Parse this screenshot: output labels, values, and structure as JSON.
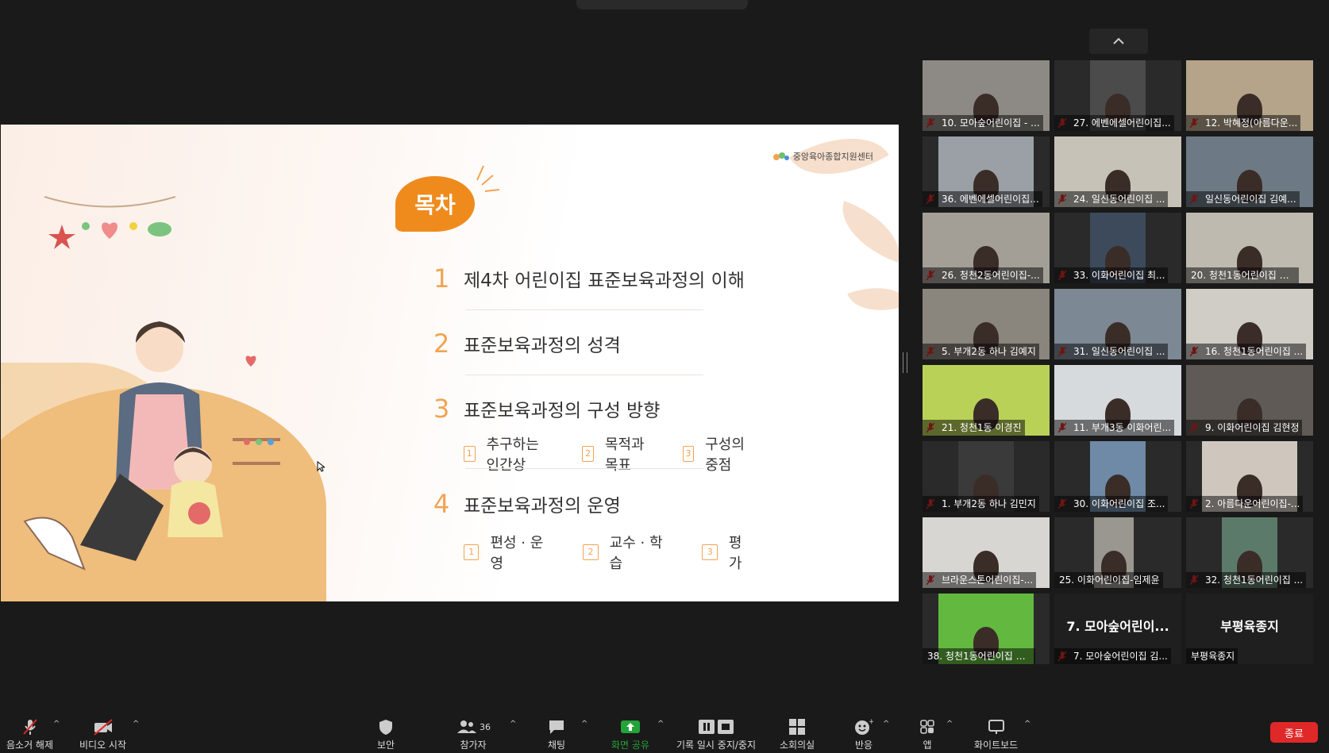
{
  "slide": {
    "logo_text": "중앙육아종합지원센터",
    "bubble_title": "목차",
    "items": [
      {
        "num": "1",
        "title": "제4차 어린이집 표준보육과정의 이해"
      },
      {
        "num": "2",
        "title": "표준보육과정의 성격"
      },
      {
        "num": "3",
        "title": "표준보육과정의 구성 방향",
        "subs": [
          {
            "n": "1",
            "label": "추구하는 인간상"
          },
          {
            "n": "2",
            "label": "목적과 목표"
          },
          {
            "n": "3",
            "label": "구성의 중점"
          }
        ]
      },
      {
        "num": "4",
        "title": "표준보육과정의 운영",
        "subs": [
          {
            "n": "1",
            "label": "편성 · 운영"
          },
          {
            "n": "2",
            "label": "교수 · 학습"
          },
          {
            "n": "3",
            "label": "평가"
          }
        ]
      }
    ],
    "accent": "#ef8b1d"
  },
  "participants": [
    {
      "label": "10. 모아숲어린이집 - ...",
      "muted": true
    },
    {
      "label": "27. 에벤에셀어린이집...",
      "muted": true
    },
    {
      "label": "12. 박혜정(아름다운...",
      "muted": true
    },
    {
      "label": "36. 에벤에셀어린이집...",
      "muted": true
    },
    {
      "label": "24. 일신동어린이집 ...",
      "muted": true
    },
    {
      "label": "일신동어린이집 김예...",
      "muted": true
    },
    {
      "label": "26. 청천2동어린이집-...",
      "muted": true
    },
    {
      "label": "33. 이화어린이집 최...",
      "muted": true
    },
    {
      "label": "20. 청천1동어린이집 유...",
      "muted": false
    },
    {
      "label": "5. 부개2동 하나 김예지",
      "muted": true
    },
    {
      "label": "31. 일신동어린이집 ...",
      "muted": true
    },
    {
      "label": "16. 청천1동어린이집 ...",
      "muted": true
    },
    {
      "label": "21. 청천1동 이경진",
      "muted": true
    },
    {
      "label": "11. 부개3동 이화어린...",
      "muted": true
    },
    {
      "label": "9. 이화어린이집 김현정",
      "muted": true
    },
    {
      "label": "1. 부개2동 하나 김민지",
      "muted": true
    },
    {
      "label": "30. 이화어린이집 조...",
      "muted": true
    },
    {
      "label": "2. 아름다운어린이집-...",
      "muted": true
    },
    {
      "label": "브라운스톤어린이집-...",
      "muted": true
    },
    {
      "label": "25. 이화어린이집-임제윤",
      "muted": false
    },
    {
      "label": "32. 청천1동어린이집 ...",
      "muted": true
    },
    {
      "label": "38. 청천1동어린이집 황...",
      "muted": false
    },
    {
      "label": "7. 모아숲어린이집 김...",
      "muted": true,
      "bigname": "7. 모아숲어린이..."
    },
    {
      "label": "부평육종지",
      "muted": false,
      "bigname": "부평육종지"
    }
  ],
  "toolbar": {
    "unmute": "음소거 해제",
    "start_video": "비디오 시작",
    "security": "보안",
    "participants": "참가자",
    "participant_count": "36",
    "chat": "채팅",
    "share_screen": "화면 공유",
    "record": "기록 일시 중지/중지",
    "breakout": "소회의실",
    "reactions": "반응",
    "apps": "앱",
    "whiteboard": "화이트보드",
    "end": "종료"
  },
  "colors": {
    "share_green": "#23a339",
    "end_red": "#e02828",
    "mute_red": "#e02828"
  }
}
